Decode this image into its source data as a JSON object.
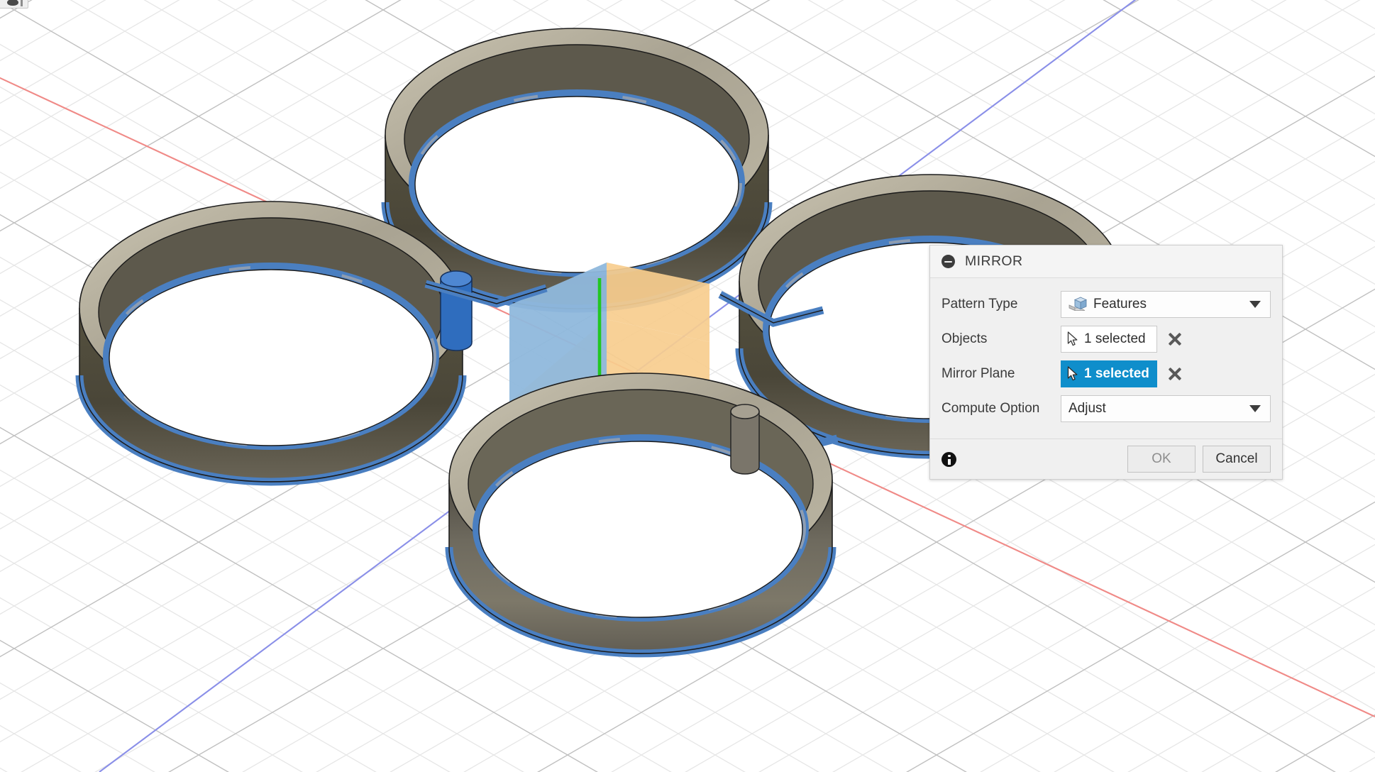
{
  "app": {
    "viewport_background": "#ffffff",
    "grid_color": "#e3e3e3",
    "grid_major_color": "#b8b8b8"
  },
  "toolbar_stub": {
    "name": "partial-toolbar-button"
  },
  "dialog": {
    "title": "MIRROR",
    "collapse_icon": "collapse-minus-icon",
    "rows": [
      {
        "label": "Pattern Type",
        "control": "dropdown",
        "icon": "features-cube-icon",
        "value": "Features"
      },
      {
        "label": "Objects",
        "control": "selection",
        "icon": "arrow-cursor-icon",
        "value": "1 selected",
        "active": false,
        "clear": "clear-selection-icon"
      },
      {
        "label": "Mirror Plane",
        "control": "selection",
        "icon": "arrow-cursor-icon",
        "value": "1 selected",
        "active": true,
        "clear": "clear-selection-icon"
      },
      {
        "label": "Compute Option",
        "control": "dropdown",
        "value": "Adjust"
      }
    ],
    "footer": {
      "info_icon": "info-icon",
      "ok_label": "OK",
      "cancel_label": "Cancel"
    },
    "accent_color": "#0f8ecb"
  },
  "model": {
    "description": "Quadcopter frame with four motor-mount rings",
    "ring_count": 4,
    "body_color": "#605b50",
    "rim_color": "#b0aa99",
    "highlight_color": "#4a7fc1",
    "axes": {
      "x_color": "#e8403a",
      "y_color": "#22c722",
      "z_color": "#3344e0"
    },
    "planes": {
      "front_color": "#7aabd4",
      "right_color": "#f3c98b"
    },
    "origin_marker": "origin-sphere"
  }
}
